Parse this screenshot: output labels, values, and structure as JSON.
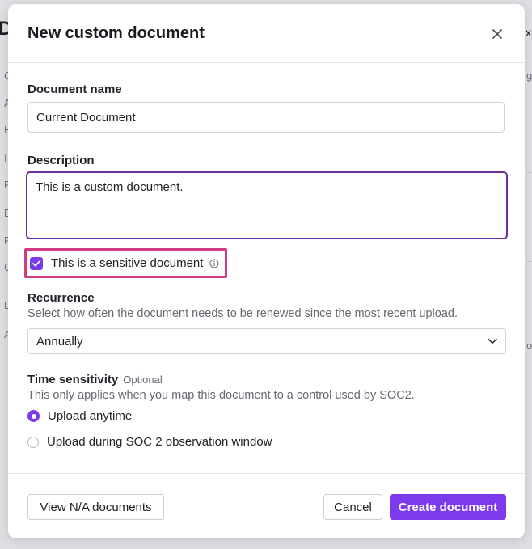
{
  "background": {
    "title_letter": "D",
    "side_letters": [
      "C",
      "A",
      "H",
      "I",
      "F",
      "E",
      "F",
      "C",
      "D",
      "A"
    ],
    "right_letters": [
      "xp",
      "g",
      "o"
    ]
  },
  "modal": {
    "title": "New custom document",
    "document_name": {
      "label": "Document name",
      "value": "Current Document"
    },
    "description": {
      "label": "Description",
      "value": "This is a custom document."
    },
    "sensitive": {
      "label": "This is a sensitive document",
      "checked": true
    },
    "recurrence": {
      "label": "Recurrence",
      "help": "Select how often the document needs to be renewed since the most recent upload.",
      "selected": "Annually"
    },
    "time_sensitivity": {
      "label": "Time sensitivity",
      "optional": "Optional",
      "help": "This only applies when you map this document to a control used by SOC2.",
      "options": [
        {
          "label": "Upload anytime",
          "checked": true
        },
        {
          "label": "Upload during SOC 2 observation window",
          "checked": false
        }
      ]
    },
    "footer": {
      "view_na_label": "View N/A documents",
      "cancel_label": "Cancel",
      "create_label": "Create document"
    }
  },
  "colors": {
    "accent": "#7c3aed",
    "focus_border": "#6b2fa0",
    "highlight": "#d23b82"
  }
}
